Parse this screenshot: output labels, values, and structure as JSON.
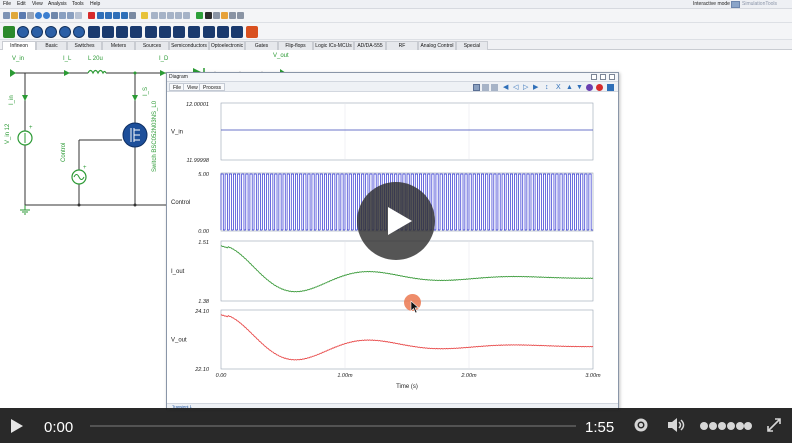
{
  "menubar": {
    "items": [
      "File",
      "Edit",
      "View",
      "Analysis",
      "Tools",
      "Help"
    ],
    "mode": "Interactive mode",
    "brand": "SimulationTools"
  },
  "tabs": [
    "Infineon",
    "Basic",
    "Switches",
    "Meters",
    "Sources",
    "Semiconductors",
    "Optoelectronic",
    "Gates",
    "Flip-flops",
    "Logic ICs-MCUs",
    "AD/DA-555",
    "RF",
    "Analog Control",
    "Special"
  ],
  "active_tab": "Infineon",
  "schematic": {
    "labels": {
      "v_in_top": "V_in",
      "i_l": "I_L",
      "inductor": "L 20u",
      "i_d": "I_D",
      "v_out": "V_out",
      "i_in": "I_in",
      "i_s": "I_S",
      "v_in_src": "V_in 12",
      "control": "Control",
      "switch": "Switch BSC052N03NS_L0"
    }
  },
  "diagram": {
    "title": "Diagram",
    "menu": [
      "File",
      "View",
      "Process"
    ],
    "footer_tab": "Transient 1",
    "traces": [
      {
        "name": "V_in",
        "y_top": "12.00001",
        "y_bottom": "11.99998",
        "color": "#3a47b8"
      },
      {
        "name": "Control",
        "y_top": "5.00",
        "y_bottom": "0.00",
        "color": "#2b2fd0"
      },
      {
        "name": "I_out",
        "y_top": "1.51",
        "y_bottom": "1.38",
        "color": "#3a9a3a"
      },
      {
        "name": "V_out",
        "y_top": "24.10",
        "y_bottom": "22.10",
        "color": "#e84a4a"
      }
    ],
    "x_ticks": [
      "0.00",
      "1.00m",
      "2.00m",
      "3.00m"
    ],
    "x_label": "Time (s)"
  },
  "player": {
    "current_time": "0:00",
    "duration": "1:55",
    "progress": 0
  }
}
